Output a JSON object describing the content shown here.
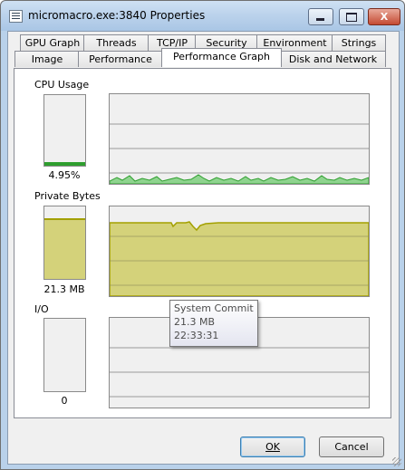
{
  "window": {
    "title": "micromacro.exe:3840 Properties"
  },
  "caption_buttons": {
    "minimize": "minimize",
    "maximize": "maximize",
    "close": "X"
  },
  "tabs": {
    "row1": [
      "GPU Graph",
      "Threads",
      "TCP/IP",
      "Security",
      "Environment",
      "Strings"
    ],
    "row2": [
      "Image",
      "Performance",
      "Performance Graph",
      "Disk and Network"
    ],
    "active": "Performance Graph"
  },
  "sections": {
    "cpu": {
      "label": "CPU Usage",
      "value": "4.95%",
      "level": 0.0495,
      "color": "#2e9e2e"
    },
    "private_bytes": {
      "label": "Private Bytes",
      "value": "21.3 MB",
      "level": 0.84,
      "color": "#d4d27a",
      "line_color": "#a3a000"
    },
    "io": {
      "label": "I/O",
      "value": "0",
      "level": 0
    }
  },
  "tooltip": {
    "title": "System Commit",
    "value": "21.3 MB",
    "time": "22:33:31"
  },
  "buttons": {
    "ok": "OK",
    "cancel": "Cancel"
  }
}
